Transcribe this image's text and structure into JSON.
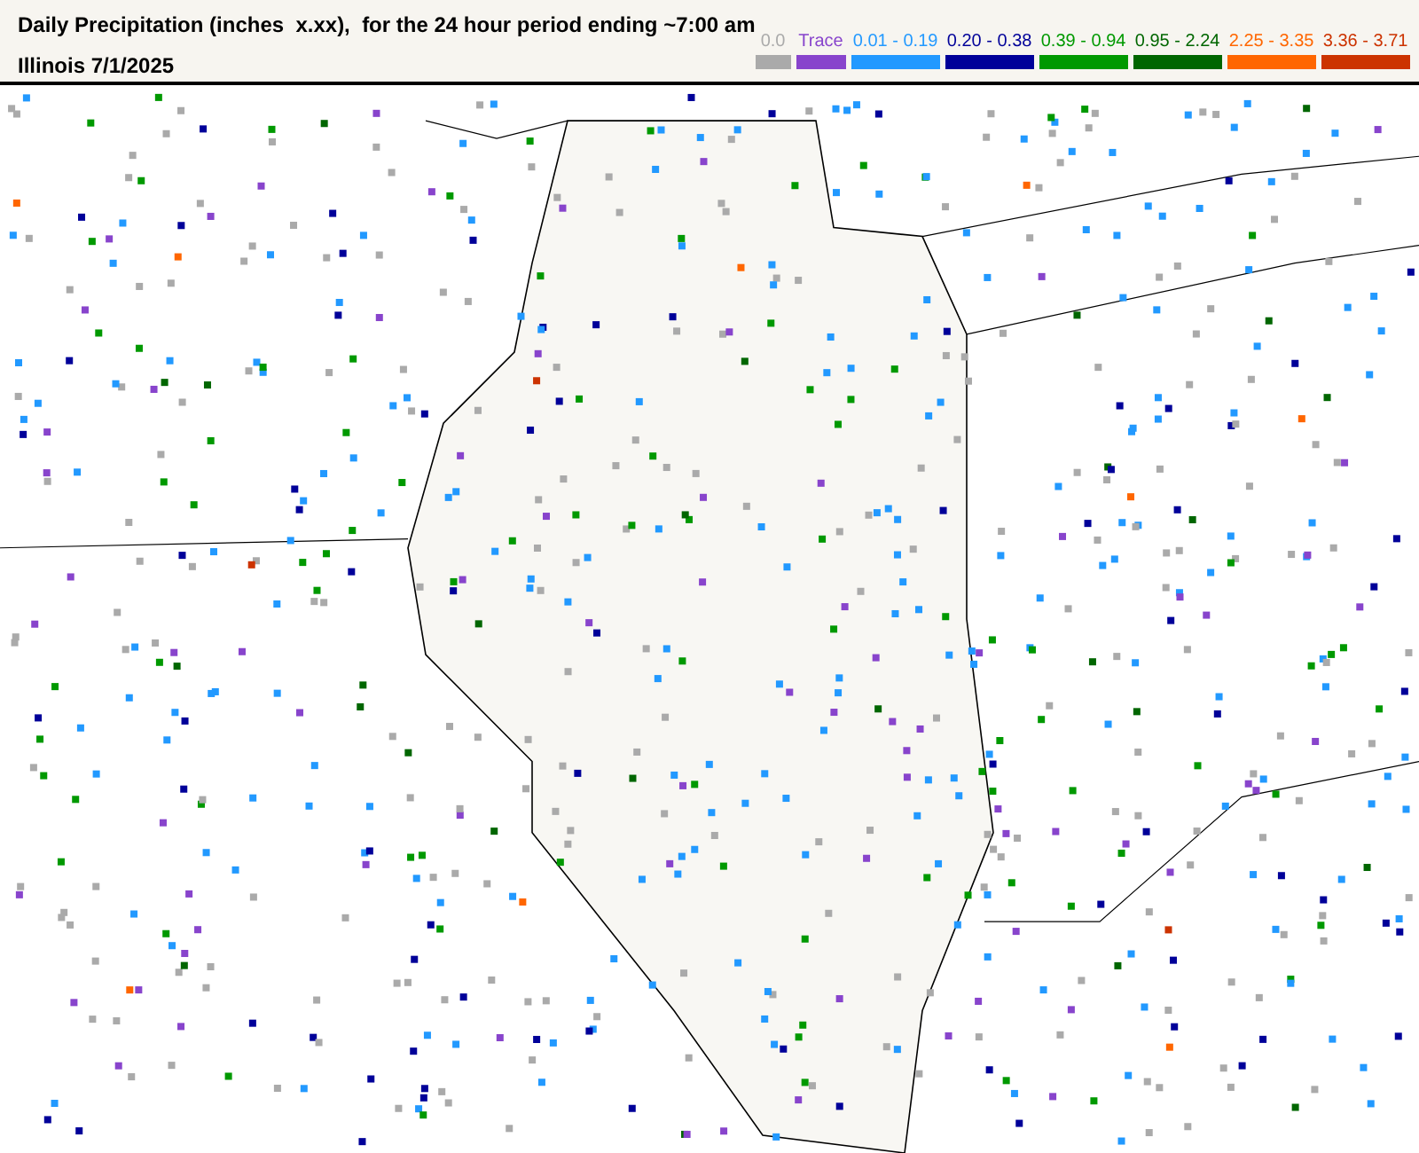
{
  "title": "Daily Precipitation (inches  x.xx),  for the 24 hour period ending ~7:00 am",
  "subtitle": "Illinois 7/1/2025",
  "legend": [
    {
      "label": "0.0",
      "color": "#aaaaaa"
    },
    {
      "label": "Trace",
      "color": "#8844cc"
    },
    {
      "label": "0.01 - 0.19",
      "color": "#2299ff"
    },
    {
      "label": "0.20 - 0.38",
      "color": "#000099"
    },
    {
      "label": "0.39 - 0.94",
      "color": "#009900"
    },
    {
      "label": "0.95 - 2.24",
      "color": "#006600"
    },
    {
      "label": "2.25 - 3.35",
      "color": "#ff6600"
    },
    {
      "label": "3.36 - 3.71",
      "color": "#cc3300"
    }
  ]
}
